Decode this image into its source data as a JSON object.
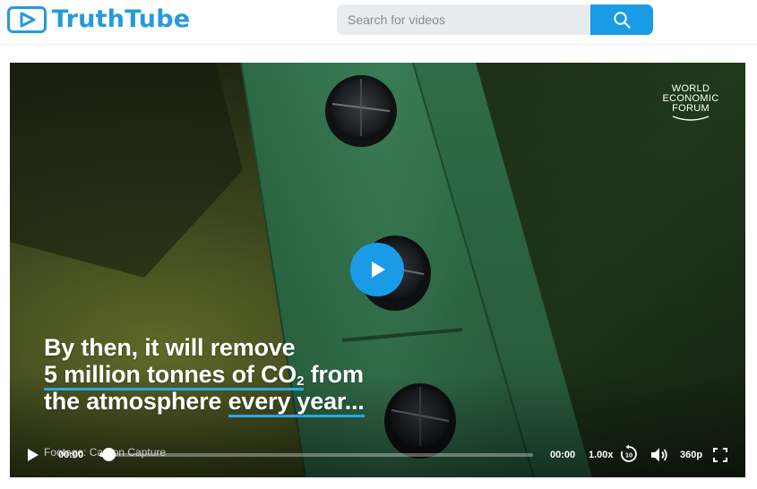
{
  "header": {
    "logo_text": "TruthTube",
    "logo_icon": "play-square-icon",
    "brand_color": "#2799dd"
  },
  "search": {
    "placeholder": "Search for videos",
    "value": "",
    "button_icon": "search-icon",
    "accent_color": "#1a9be6"
  },
  "video": {
    "watermark_lines": [
      "WORLD",
      "ECONOMIC",
      "FORUM"
    ],
    "play_icon": "play-icon",
    "caption": {
      "line1": "By then, it will remove",
      "line2_hl": "5 million tonnes of CO",
      "line2_sub": "2",
      "line2_rest": " from",
      "line3_a": "the atmosphere ",
      "line3_hl": "every year...",
      "highlight_color": "#2aa8e8"
    },
    "footage_credit": "Footage: Carbon Capture"
  },
  "controls": {
    "current_time": "00:00",
    "duration": "00:00",
    "progress": 0.02,
    "speed": "1.00x",
    "rewind_seconds": "10",
    "quality": "360p",
    "icons": [
      "play-icon",
      "rewind-10-icon",
      "volume-icon",
      "fullscreen-icon"
    ]
  }
}
